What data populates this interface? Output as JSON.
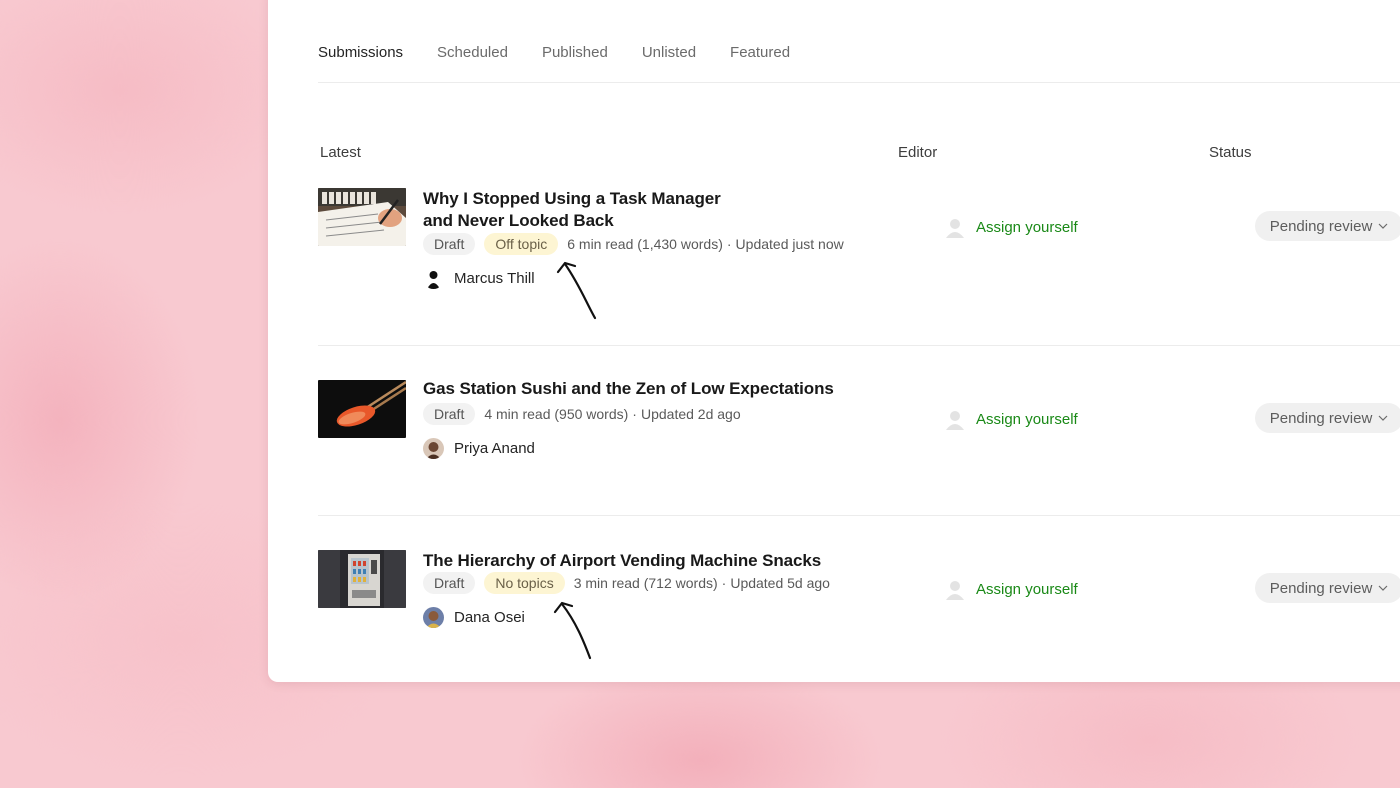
{
  "tabs": [
    {
      "label": "Submissions",
      "active": true
    },
    {
      "label": "Scheduled",
      "active": false
    },
    {
      "label": "Published",
      "active": false
    },
    {
      "label": "Unlisted",
      "active": false
    },
    {
      "label": "Featured",
      "active": false
    }
  ],
  "columns": {
    "latest": "Latest",
    "editor": "Editor",
    "status": "Status"
  },
  "submissions": [
    {
      "title": "Why I Stopped Using a Task Manager and Never Looked Back",
      "draft_label": "Draft",
      "topic_chip": "Off topic",
      "meta": "6 min read (1,430 words)",
      "updated": "Updated just now",
      "author": "Marcus Thill",
      "editor_action": "Assign yourself",
      "status": "Pending review",
      "thumbnail_icon": "notebook-handwriting-image"
    },
    {
      "title": "Gas Station Sushi and the Zen of Low Expectations",
      "draft_label": "Draft",
      "topic_chip": "",
      "meta": "4 min read (950 words)",
      "updated": "Updated 2d ago",
      "author": "Priya Anand",
      "editor_action": "Assign yourself",
      "status": "Pending review",
      "thumbnail_icon": "sushi-chopsticks-image"
    },
    {
      "title": "The Hierarchy of Airport Vending Machine Snacks",
      "draft_label": "Draft",
      "topic_chip": "No topics",
      "meta": "3 min read (712 words)",
      "updated": "Updated 5d ago",
      "author": "Dana Osei",
      "editor_action": "Assign yourself",
      "status": "Pending review",
      "thumbnail_icon": "vending-machine-image"
    }
  ],
  "colors": {
    "accent_green": "#1a8917",
    "warning_chip": "#fdf5d3",
    "background_pink": "#f8c9d0"
  }
}
